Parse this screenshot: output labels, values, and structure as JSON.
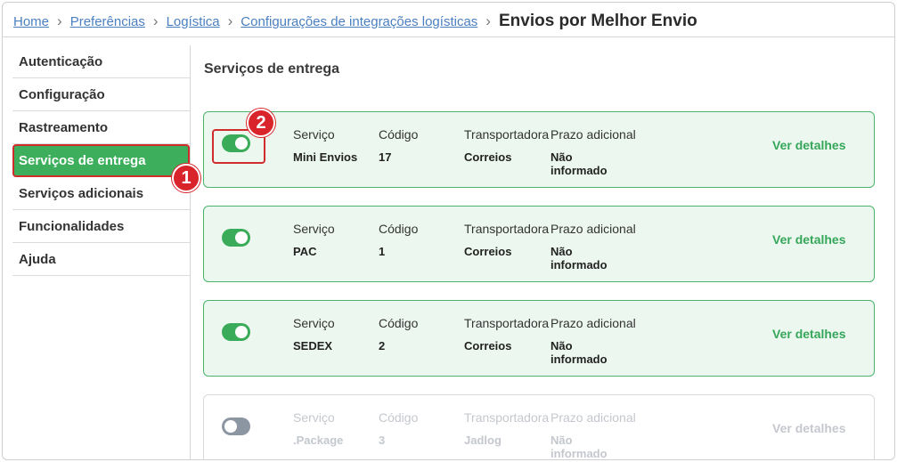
{
  "breadcrumb": {
    "items": [
      "Home",
      "Preferências",
      "Logística",
      "Configurações de integrações logísticas"
    ],
    "current": "Envios por Melhor Envio"
  },
  "sidebar": {
    "items": [
      {
        "label": "Autenticação"
      },
      {
        "label": "Configuração"
      },
      {
        "label": "Rastreamento"
      },
      {
        "label": "Serviços de entrega",
        "active": true
      },
      {
        "label": "Serviços adicionais"
      },
      {
        "label": "Funcionalidades"
      },
      {
        "label": "Ajuda"
      }
    ]
  },
  "main": {
    "section_title": "Serviços de entrega",
    "column_labels": {
      "service": "Serviço",
      "code": "Código",
      "carrier": "Transportadora",
      "extra_time": "Prazo adicional"
    },
    "details_label": "Ver detalhes",
    "services": [
      {
        "service": "Mini Envios",
        "code": "17",
        "carrier": "Correios",
        "extra_time_1": "Não",
        "extra_time_2": "informado",
        "enabled": true
      },
      {
        "service": "PAC",
        "code": "1",
        "carrier": "Correios",
        "extra_time_1": "Não",
        "extra_time_2": "informado",
        "enabled": true
      },
      {
        "service": "SEDEX",
        "code": "2",
        "carrier": "Correios",
        "extra_time_1": "Não",
        "extra_time_2": "informado",
        "enabled": true
      },
      {
        "service": ".Package",
        "code": "3",
        "carrier": "Jadlog",
        "extra_time_1": "Não",
        "extra_time_2": "informado",
        "enabled": false
      }
    ]
  },
  "annotations": {
    "step_1": "1",
    "step_2": "2"
  },
  "colors": {
    "accent": "#3daf5c",
    "highlight": "#d12c2c",
    "link": "#4a7fc0"
  }
}
